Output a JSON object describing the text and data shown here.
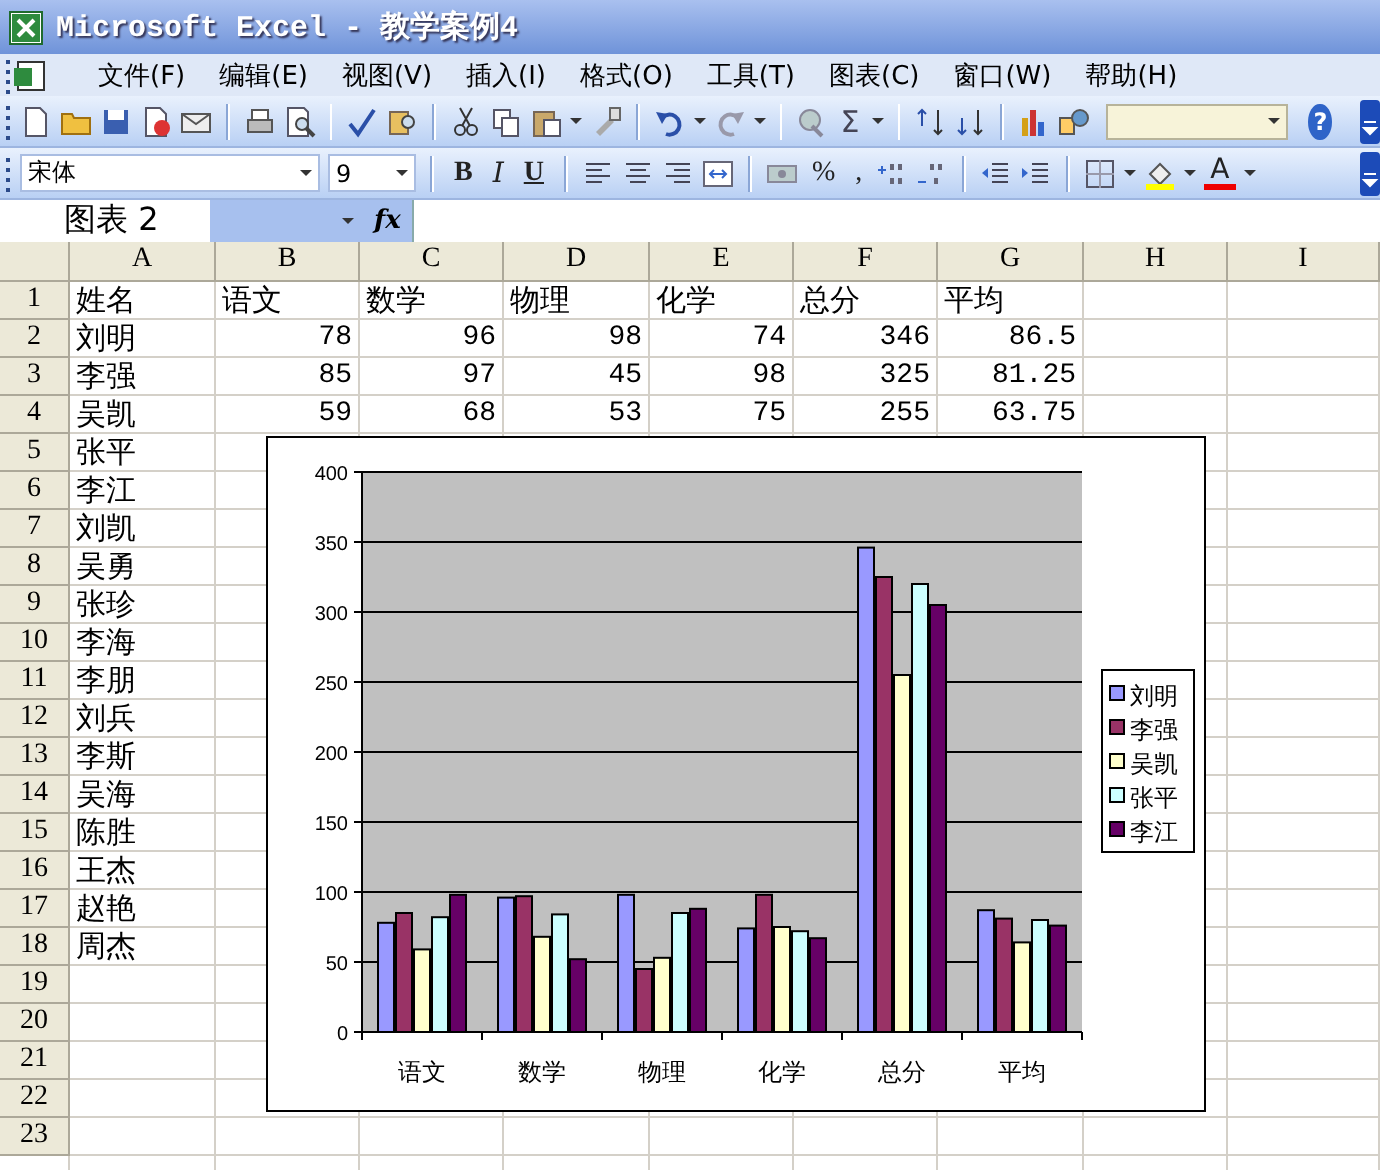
{
  "window": {
    "title": "Microsoft Excel - 教学案例4"
  },
  "menu": [
    "文件(F)",
    "编辑(E)",
    "视图(V)",
    "插入(I)",
    "格式(O)",
    "工具(T)",
    "图表(C)",
    "窗口(W)",
    "帮助(H)"
  ],
  "standard_toolbar": {
    "sum": "Σ",
    "help": "?"
  },
  "formatting_toolbar": {
    "font": "宋体",
    "size": "9",
    "bold": "B",
    "italic": "I",
    "underline": "U",
    "percent": "%",
    "comma": ",",
    "font_color": "A"
  },
  "formula_bar": {
    "name_box": "图表 2",
    "function_label": "fx"
  },
  "sheet": {
    "columns": [
      "A",
      "B",
      "C",
      "D",
      "E",
      "F",
      "G",
      "H",
      "I"
    ],
    "rows": [
      {
        "number": "1",
        "name": "姓名",
        "values": [
          "语文",
          "数学",
          "物理",
          "化学",
          "总分",
          "平均"
        ]
      },
      {
        "number": "2",
        "name": "刘明",
        "values": [
          "78",
          "96",
          "98",
          "74",
          "346",
          "86.5"
        ]
      },
      {
        "number": "3",
        "name": "李强",
        "values": [
          "85",
          "97",
          "45",
          "98",
          "325",
          "81.25"
        ]
      },
      {
        "number": "4",
        "name": "吴凯",
        "values": [
          "59",
          "68",
          "53",
          "75",
          "255",
          "63.75"
        ]
      },
      {
        "number": "5",
        "name": "张平"
      },
      {
        "number": "6",
        "name": "李江"
      },
      {
        "number": "7",
        "name": "刘凯"
      },
      {
        "number": "8",
        "name": "吴勇"
      },
      {
        "number": "9",
        "name": "张珍"
      },
      {
        "number": "10",
        "name": "李海"
      },
      {
        "number": "11",
        "name": "李朋"
      },
      {
        "number": "12",
        "name": "刘兵"
      },
      {
        "number": "13",
        "name": "李斯"
      },
      {
        "number": "14",
        "name": "吴海"
      },
      {
        "number": "15",
        "name": "陈胜"
      },
      {
        "number": "16",
        "name": "王杰"
      },
      {
        "number": "17",
        "name": "赵艳"
      },
      {
        "number": "18",
        "name": "周杰"
      },
      {
        "number": "19"
      },
      {
        "number": "20"
      },
      {
        "number": "21"
      },
      {
        "number": "22"
      },
      {
        "number": "23"
      }
    ]
  },
  "chart": {
    "chart_data": {
      "type": "bar",
      "categories": [
        "语文",
        "数学",
        "物理",
        "化学",
        "总分",
        "平均"
      ],
      "series": [
        {
          "name": "刘明",
          "color": "#9999ff",
          "values": [
            78,
            96,
            98,
            74,
            346,
            87
          ]
        },
        {
          "name": "李强",
          "color": "#993366",
          "values": [
            85,
            97,
            45,
            98,
            325,
            81
          ]
        },
        {
          "name": "吴凯",
          "color": "#ffffcc",
          "values": [
            59,
            68,
            53,
            75,
            255,
            64
          ]
        },
        {
          "name": "张平",
          "color": "#ccffff",
          "values": [
            82,
            84,
            85,
            72,
            320,
            80
          ]
        },
        {
          "name": "李江",
          "color": "#660066",
          "values": [
            98,
            52,
            88,
            67,
            305,
            76
          ]
        }
      ],
      "grid": {
        "y": true
      },
      "legend": true,
      "ylim": [
        0,
        400
      ],
      "yticks": [
        0,
        50,
        100,
        150,
        200,
        250,
        300,
        350,
        400
      ]
    }
  }
}
